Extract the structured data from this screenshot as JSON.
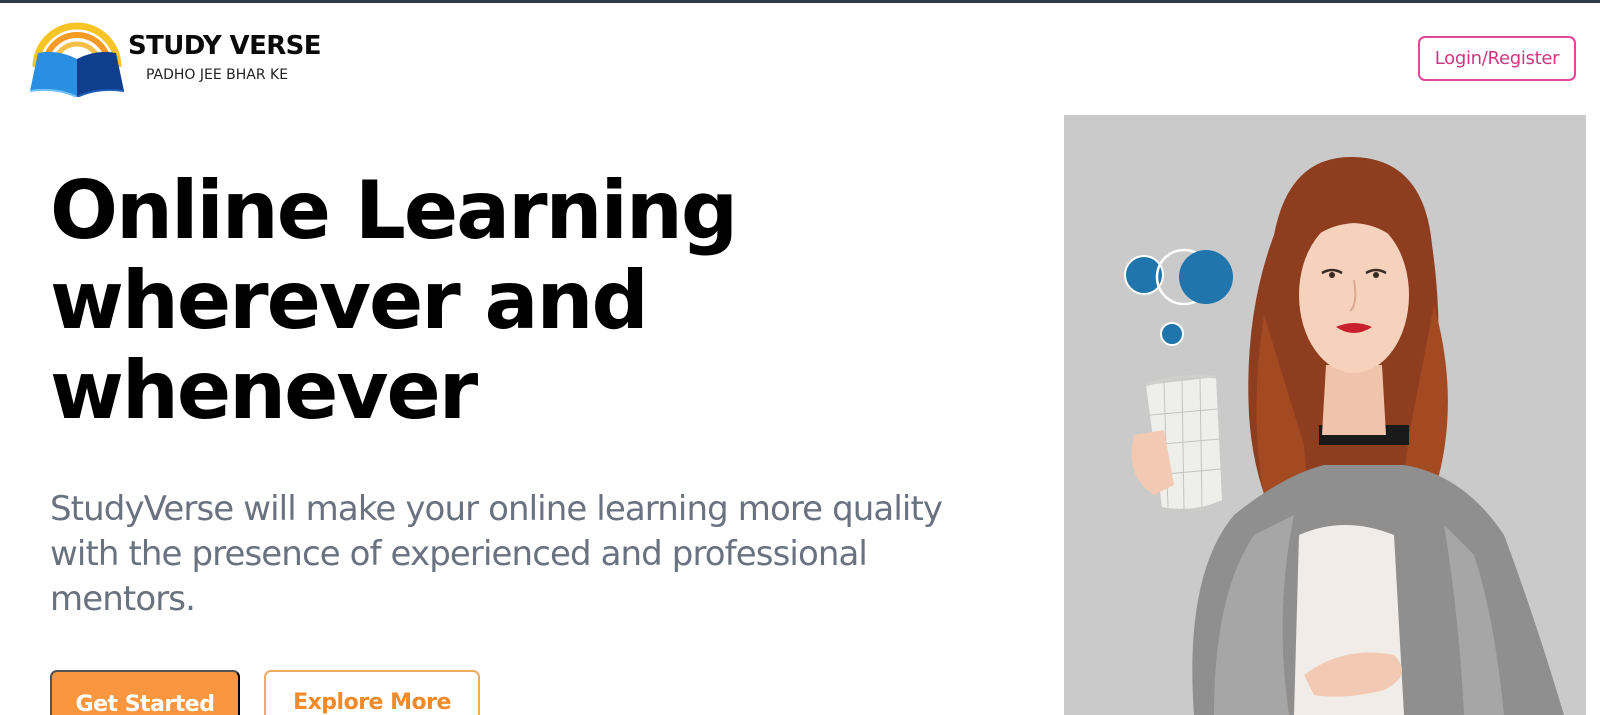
{
  "header": {
    "logo": {
      "title": "STUDY VERSE",
      "tagline": "PADHO JEE BHAR KE",
      "icon": "open-book-rainbow-icon"
    },
    "login_label": "Login/Register"
  },
  "hero": {
    "title_lines": [
      "Online Learning",
      "wherever and",
      "whenever"
    ],
    "description": "StudyVerse will make your online learning more quality with the presence of experienced and professional mentors.",
    "primary_button": "Get Started",
    "secondary_button": "Explore More",
    "image": "woman-holding-mug-photo"
  },
  "colors": {
    "accent_orange": "#fa963f",
    "login_pink": "#e0489a",
    "text_muted": "#6a7280",
    "image_bg": "#cacaca"
  }
}
